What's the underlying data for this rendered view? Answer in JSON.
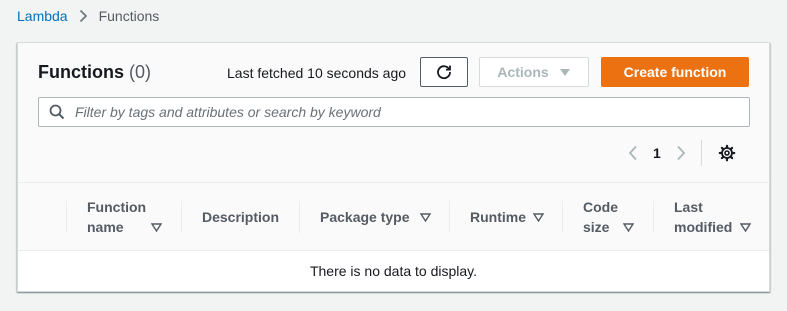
{
  "breadcrumb": {
    "root": "Lambda",
    "current": "Functions"
  },
  "panel": {
    "title": "Functions",
    "count": "(0)",
    "last_fetched": "Last fetched 10 seconds ago",
    "actions_label": "Actions",
    "create_label": "Create function",
    "search_placeholder": "Filter by tags and attributes or search by keyword",
    "page_number": "1"
  },
  "table": {
    "columns": [
      {
        "line1": "Function",
        "line2": "name"
      },
      {
        "line1": "Description"
      },
      {
        "line1": "Package type"
      },
      {
        "line1": "Runtime"
      },
      {
        "line1": "Code",
        "line2": "size"
      },
      {
        "line1": "Last",
        "line2": "modified"
      }
    ],
    "empty_message": "There is no data to display."
  },
  "colors": {
    "primary": "#ec7211",
    "link": "#0073bb",
    "border": "#d5dbdb",
    "disabled": "#aab7b8"
  },
  "icons": [
    "chevron-right-icon",
    "refresh-icon",
    "caret-down-icon",
    "search-icon",
    "chevron-left-icon",
    "gear-icon",
    "sort-caret-icon"
  ]
}
